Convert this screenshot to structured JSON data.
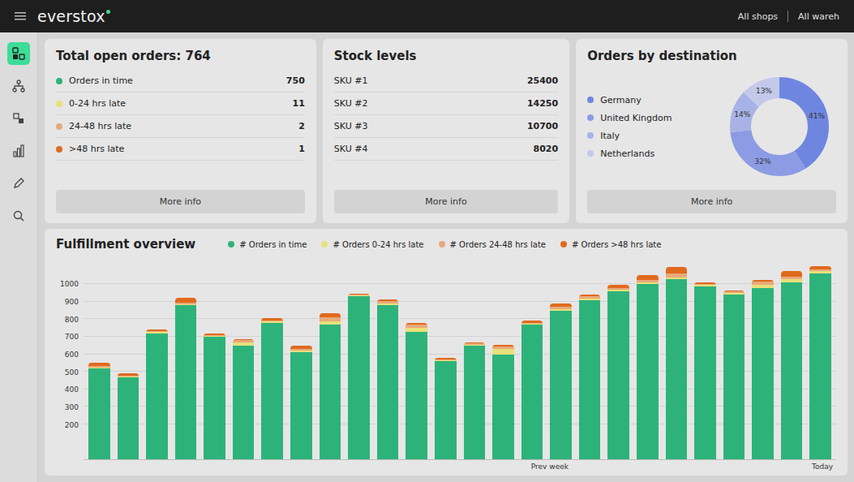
{
  "topbar": {
    "logo": "everstox",
    "filters": [
      "All shops",
      "All wareh"
    ]
  },
  "sidebar": {
    "items": [
      {
        "kind": "dashboard",
        "selected": true
      },
      {
        "kind": "network",
        "selected": false
      },
      {
        "kind": "boxes",
        "selected": false
      },
      {
        "kind": "chart",
        "selected": false
      },
      {
        "kind": "edit",
        "selected": false
      },
      {
        "kind": "search",
        "selected": false
      }
    ]
  },
  "open_orders": {
    "title": "Total open orders: 764",
    "rows": [
      {
        "label": "Orders in time",
        "count": "750",
        "color": "#2db37a"
      },
      {
        "label": "0-24 hrs late",
        "count": "11",
        "color": "#e8e07a"
      },
      {
        "label": "24-48 hrs late",
        "count": "2",
        "color": "#e8a97a"
      },
      {
        "label": ">48 hrs late",
        "count": "1",
        "color": "#e06a1e"
      }
    ],
    "button": "More info"
  },
  "stock": {
    "title": "Stock levels",
    "rows": [
      {
        "sku": "SKU #1",
        "qty": "25400"
      },
      {
        "sku": "SKU #2",
        "qty": "14250"
      },
      {
        "sku": "SKU #3",
        "qty": "10700"
      },
      {
        "sku": "SKU #4",
        "qty": "8020"
      }
    ],
    "button": "More info"
  },
  "destinations": {
    "title": "Orders by destination",
    "items": [
      {
        "label": "Germany",
        "share": 0.41,
        "percent": "41%",
        "color": "#6f86e0"
      },
      {
        "label": "United Kingdom",
        "share": 0.32,
        "percent": "32%",
        "color": "#8c9be3"
      },
      {
        "label": "Italy",
        "share": 0.14,
        "percent": "14%",
        "color": "#a9b2e6"
      },
      {
        "label": "Netherlands",
        "share": 0.13,
        "percent": "13%",
        "color": "#c4c9ea"
      }
    ],
    "button": "More info"
  },
  "fulfillment": {
    "title": "Fulfillment overview",
    "y_ticks": [
      "1000",
      "900",
      "800",
      "700",
      "600",
      "500",
      "400",
      "300",
      "200"
    ],
    "x_labels": [
      "Prev week",
      "Today"
    ],
    "series": [
      {
        "label": "# Orders in time",
        "color": "#2db37a",
        "values": [
          520,
          470,
          720,
          880,
          700,
          650,
          780,
          610,
          770,
          930,
          880,
          730,
          560,
          650,
          600,
          770,
          850,
          910,
          960,
          1000,
          1030,
          990,
          940,
          980,
          1010,
          1060
        ]
      },
      {
        "label": "# Orders 0-24 hrs late",
        "color": "#e8e07a",
        "values": [
          5,
          5,
          10,
          5,
          5,
          20,
          10,
          10,
          20,
          5,
          10,
          20,
          5,
          5,
          30,
          5,
          10,
          10,
          10,
          10,
          10,
          5,
          10,
          15,
          20,
          15
        ]
      },
      {
        "label": "# Orders 24-48 hrs late",
        "color": "#e8a97a",
        "values": [
          10,
          5,
          5,
          10,
          5,
          10,
          5,
          10,
          20,
          5,
          15,
          20,
          5,
          10,
          15,
          5,
          10,
          10,
          10,
          15,
          20,
          5,
          10,
          20,
          15,
          10
        ]
      },
      {
        "label": "# Orders >48 hrs late",
        "color": "#e06a1e",
        "values": [
          15,
          10,
          5,
          30,
          10,
          5,
          10,
          20,
          25,
          5,
          10,
          10,
          10,
          5,
          10,
          15,
          20,
          10,
          15,
          30,
          40,
          10,
          5,
          10,
          30,
          20
        ]
      }
    ]
  }
}
